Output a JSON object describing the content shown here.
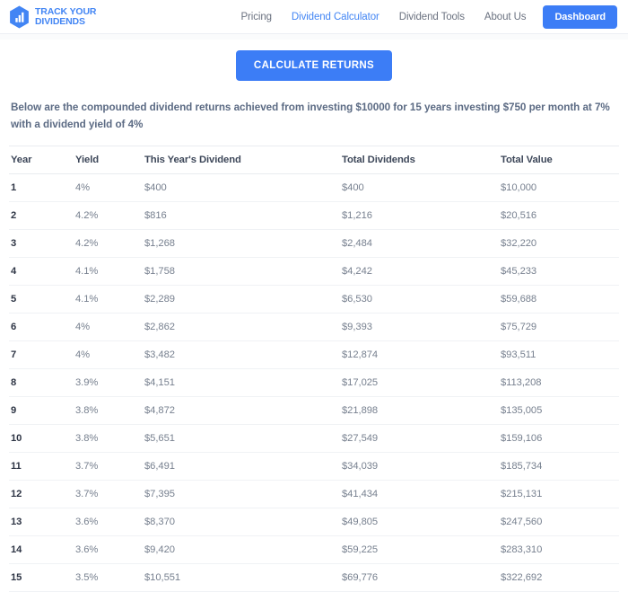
{
  "header": {
    "logo": {
      "icon": "bar-chart-hexagon-icon",
      "line1": "TRACK YOUR",
      "line2": "DIVIDENDS"
    },
    "nav": [
      {
        "label": "Pricing",
        "active": false
      },
      {
        "label": "Dividend Calculator",
        "active": true
      },
      {
        "label": "Dividend Tools",
        "active": false
      },
      {
        "label": "About Us",
        "active": false
      }
    ],
    "cta": {
      "label": "Dashboard"
    }
  },
  "main": {
    "calculate_button": "CALCULATE RETURNS",
    "summary": "Below are the compounded dividend returns achieved from investing $10000 for 15 years investing $750 per month at 7% with a dividend yield of 4%",
    "table": {
      "columns": [
        "Year",
        "Yield",
        "This Year's Dividend",
        "Total Dividends",
        "Total Value"
      ],
      "rows": [
        [
          "1",
          "4%",
          "$400",
          "$400",
          "$10,000"
        ],
        [
          "2",
          "4.2%",
          "$816",
          "$1,216",
          "$20,516"
        ],
        [
          "3",
          "4.2%",
          "$1,268",
          "$2,484",
          "$32,220"
        ],
        [
          "4",
          "4.1%",
          "$1,758",
          "$4,242",
          "$45,233"
        ],
        [
          "5",
          "4.1%",
          "$2,289",
          "$6,530",
          "$59,688"
        ],
        [
          "6",
          "4%",
          "$2,862",
          "$9,393",
          "$75,729"
        ],
        [
          "7",
          "4%",
          "$3,482",
          "$12,874",
          "$93,511"
        ],
        [
          "8",
          "3.9%",
          "$4,151",
          "$17,025",
          "$113,208"
        ],
        [
          "9",
          "3.8%",
          "$4,872",
          "$21,898",
          "$135,005"
        ],
        [
          "10",
          "3.8%",
          "$5,651",
          "$27,549",
          "$159,106"
        ],
        [
          "11",
          "3.7%",
          "$6,491",
          "$34,039",
          "$185,734"
        ],
        [
          "12",
          "3.7%",
          "$7,395",
          "$41,434",
          "$215,131"
        ],
        [
          "13",
          "3.6%",
          "$8,370",
          "$49,805",
          "$247,560"
        ],
        [
          "14",
          "3.6%",
          "$9,420",
          "$59,225",
          "$283,310"
        ],
        [
          "15",
          "3.5%",
          "$10,551",
          "$69,776",
          "$322,692"
        ]
      ]
    }
  },
  "colors": {
    "brand_blue": "#4285f4",
    "button_blue": "#3c7df6",
    "summary_text": "#5c6b84",
    "cell_text": "#77808f",
    "header_text": "#3d4759",
    "row_border": "#f0f2f5"
  }
}
